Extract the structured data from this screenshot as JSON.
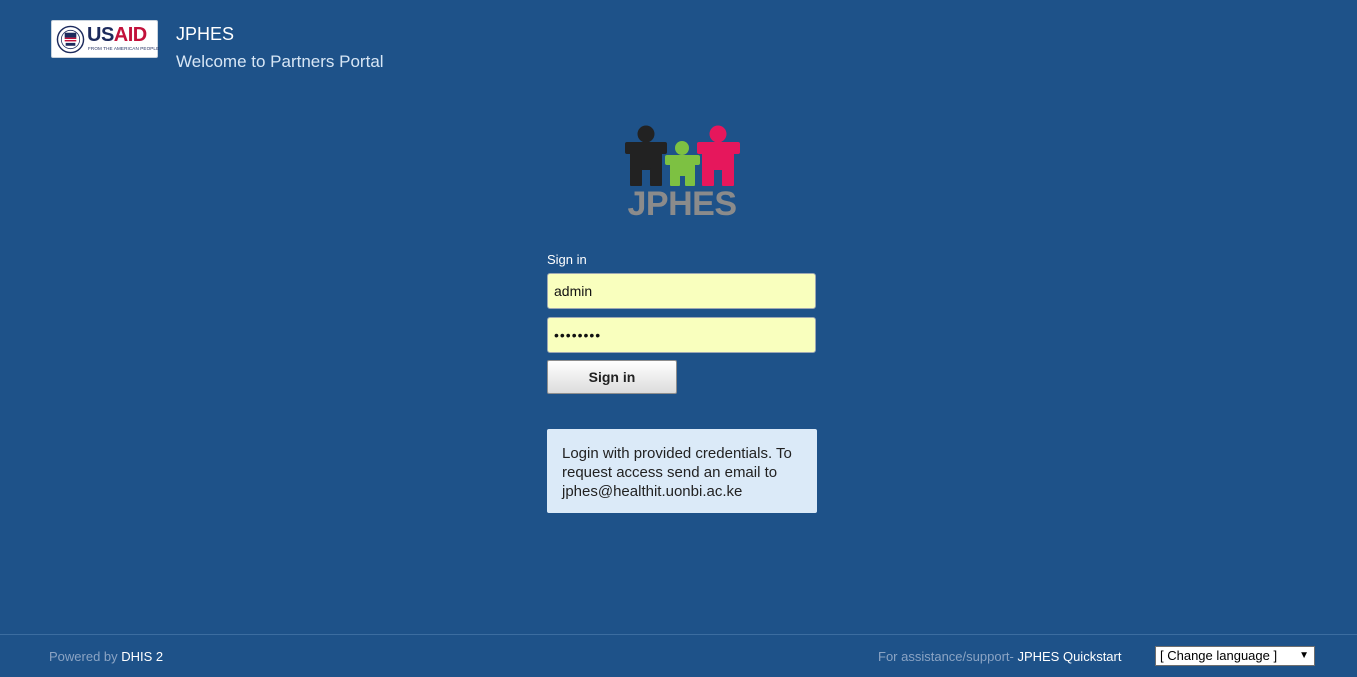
{
  "header": {
    "logo_us": "US",
    "logo_aid": "AID",
    "logo_tagline": "FROM THE AMERICAN PEOPLE",
    "title": "JPHES",
    "subtitle": "Welcome to Partners Portal"
  },
  "brand": {
    "wordmark": "JPHES",
    "figure_colors": [
      "#222222",
      "#7dc142",
      "#e6175c"
    ]
  },
  "login": {
    "heading": "Sign in",
    "username_value": "admin",
    "password_value": "••••••••",
    "submit_label": "Sign in",
    "info_text": "Login with provided credentials. To request access send an email to jphes@healthit.uonbi.ac.ke"
  },
  "footer": {
    "powered_by_prefix": "Powered by ",
    "powered_by_link": "DHIS 2",
    "support_prefix": "For assistance/support- ",
    "support_link": "JPHES Quickstart",
    "language_selected": "[ Change language ]"
  },
  "colors": {
    "background": "#1e5289",
    "input_background": "#f9ffbe",
    "info_background": "#dbeaf8"
  }
}
